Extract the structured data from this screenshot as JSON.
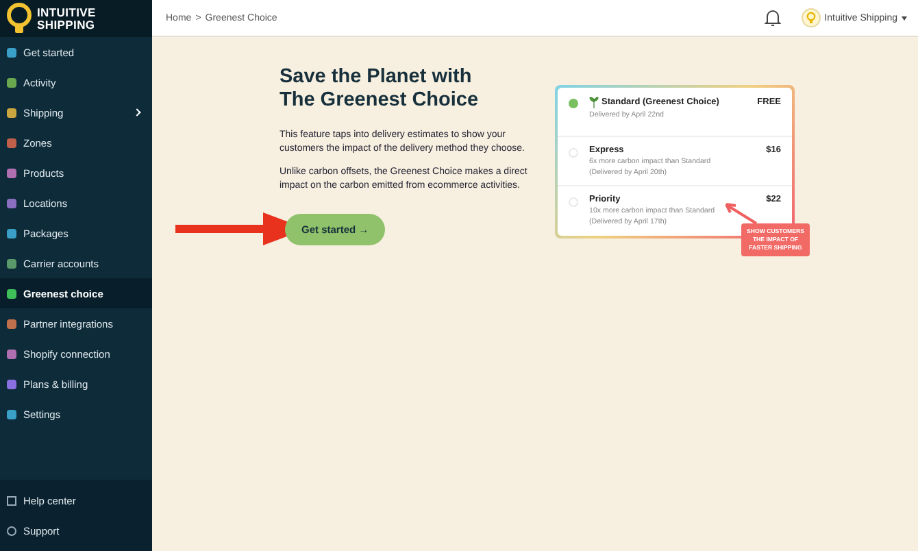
{
  "brand": {
    "line1": "INTUITIVE",
    "line2": "SHIPPING"
  },
  "sidebar": {
    "items": [
      {
        "label": "Get started",
        "selected": false,
        "color": "#3aa0c8",
        "expandable": false
      },
      {
        "label": "Activity",
        "selected": false,
        "color": "#6aa84f",
        "expandable": false
      },
      {
        "label": "Shipping",
        "selected": false,
        "color": "#c9a640",
        "expandable": true
      },
      {
        "label": "Zones",
        "selected": false,
        "color": "#c0604a",
        "expandable": false
      },
      {
        "label": "Products",
        "selected": false,
        "color": "#b06fb0",
        "expandable": false
      },
      {
        "label": "Locations",
        "selected": false,
        "color": "#8a6fc0",
        "expandable": false
      },
      {
        "label": "Packages",
        "selected": false,
        "color": "#3a9fc8",
        "expandable": false
      },
      {
        "label": "Carrier accounts",
        "selected": false,
        "color": "#5a9a6a",
        "expandable": false
      },
      {
        "label": "Greenest choice",
        "selected": true,
        "color": "#3fbf5a",
        "expandable": false
      },
      {
        "label": "Partner integrations",
        "selected": false,
        "color": "#c0704a",
        "expandable": false
      },
      {
        "label": "Shopify connection",
        "selected": false,
        "color": "#b06fb0",
        "expandable": false
      },
      {
        "label": "Plans & billing",
        "selected": false,
        "color": "#8a6fe0",
        "expandable": false
      },
      {
        "label": "Settings",
        "selected": false,
        "color": "#3aa0c8",
        "expandable": false
      }
    ],
    "footer": [
      {
        "label": "Help center"
      },
      {
        "label": "Support"
      }
    ]
  },
  "breadcrumb": {
    "items": [
      "Home",
      "Greenest Choice"
    ],
    "separator": ">"
  },
  "account": {
    "name": "Intuitive Shipping"
  },
  "hero": {
    "title_line1": "Save the Planet with",
    "title_line2": "The Greenest Choice",
    "paragraphs": [
      "This feature taps into delivery estimates to show your customers the impact of the delivery method they choose.",
      "Unlike carbon offsets, the Greenest Choice makes a direct impact on the carbon emitted from ecommerce activities."
    ],
    "button": "Get started →"
  },
  "options": [
    {
      "name": "Standard (Greenest Choice)",
      "price": "FREE",
      "lines": [
        "Delivered by April 22nd"
      ],
      "selected": true,
      "sprout": true
    },
    {
      "name": "Express",
      "price": "$16",
      "lines": [
        "6x more carbon impact than Standard",
        "(Delivered by April 20th)"
      ],
      "selected": false,
      "sprout": false
    },
    {
      "name": "Priority",
      "price": "$22",
      "lines": [
        "10x more carbon impact than Standard",
        "(Delivered by April 17th)"
      ],
      "selected": false,
      "sprout": false
    }
  ],
  "callout": "SHOW CUSTOMERS THE IMPACT OF FASTER SHIPPING"
}
